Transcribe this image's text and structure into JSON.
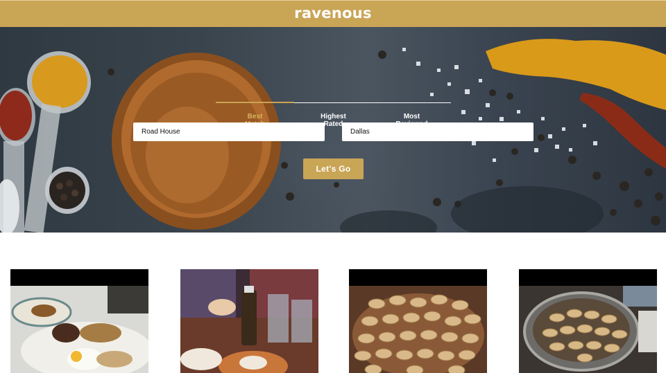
{
  "header": {
    "logo": "ravenous"
  },
  "search": {
    "sort_options": [
      {
        "line1": "Best",
        "line2": "Match",
        "active": true
      },
      {
        "line1": "Highest",
        "line2": "Rated",
        "active": false
      },
      {
        "line1": "Most",
        "line2": "Reviewed",
        "active": false
      }
    ],
    "term_value": "Road House",
    "location_value": "Dallas",
    "submit_label": "Let's Go"
  },
  "colors": {
    "accent": "#c9a556",
    "tab_active": "#d8b45e",
    "hero_bg": "#3a444d",
    "card_top_band": "#000000"
  },
  "businesses": [
    {
      "image": "steak-and-eggs-plate-photo"
    },
    {
      "image": "restaurant-table-onion-photo"
    },
    {
      "image": "peanuts-bowl-photo"
    },
    {
      "image": "peanuts-bucket-photo"
    }
  ]
}
